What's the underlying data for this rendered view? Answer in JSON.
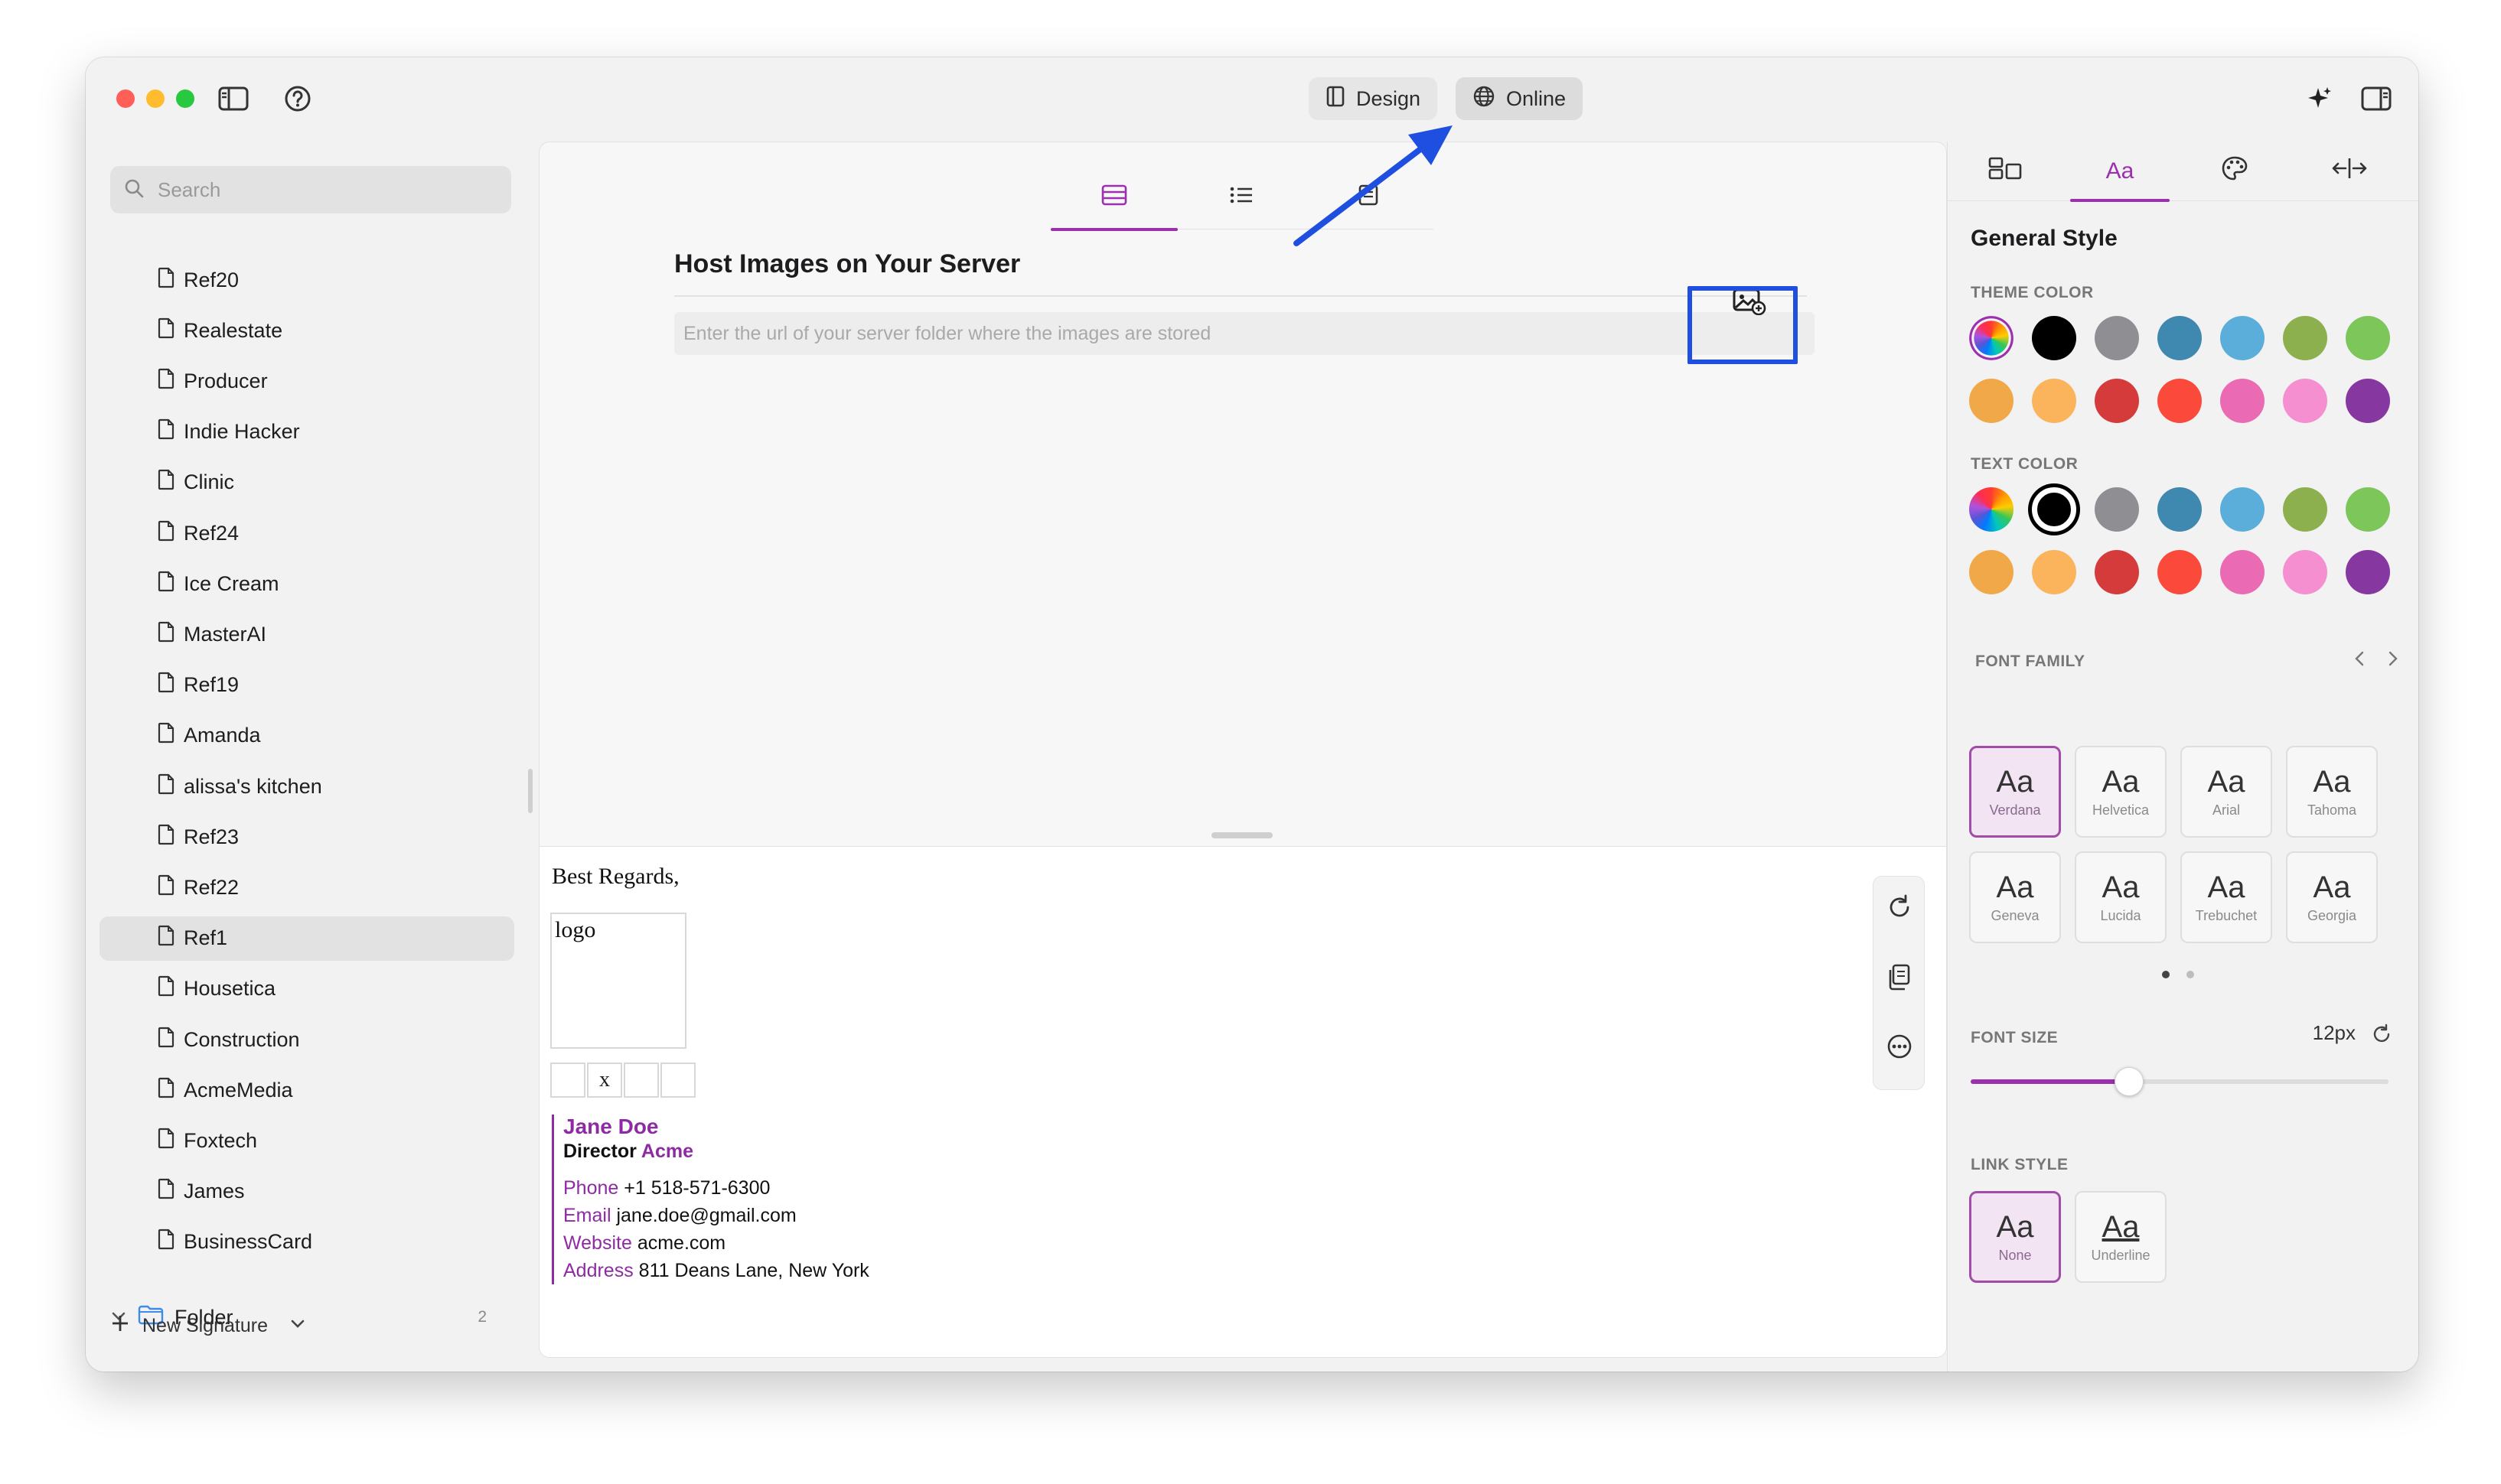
{
  "colors": {
    "accent": "#9b2fae",
    "annotation": "#1f4fe0",
    "traffic_red": "#ff5f57",
    "traffic_yellow": "#febc2e",
    "traffic_green": "#28c840"
  },
  "toolbar": {
    "design_label": "Design",
    "online_label": "Online",
    "active_mode": "Online"
  },
  "icons": {
    "sidebar_toggle": "sidebar-toggle-icon",
    "help": "help-icon",
    "design": "design-icon",
    "globe": "globe-icon",
    "ai_sparkle": "sparkle-icon",
    "inspector_toggle": "inspector-toggle-icon",
    "search": "search-icon",
    "document": "document-icon",
    "folder": "folder-icon",
    "image_upload": "image-upload-icon",
    "refresh": "refresh-icon",
    "copy": "copy-icon",
    "more": "more-icon"
  },
  "sidebar": {
    "search_placeholder": "Search",
    "items": [
      {
        "label": "Ref20"
      },
      {
        "label": "Realestate"
      },
      {
        "label": "Producer"
      },
      {
        "label": "Indie Hacker"
      },
      {
        "label": "Clinic"
      },
      {
        "label": "Ref24"
      },
      {
        "label": "Ice Cream"
      },
      {
        "label": "MasterAI"
      },
      {
        "label": "Ref19"
      },
      {
        "label": "Amanda"
      },
      {
        "label": "alissa's kitchen"
      },
      {
        "label": "Ref23"
      },
      {
        "label": "Ref22"
      },
      {
        "label": "Ref1",
        "selected": true
      },
      {
        "label": "Housetica"
      },
      {
        "label": "Construction"
      },
      {
        "label": "AcmeMedia"
      },
      {
        "label": "Foxtech"
      },
      {
        "label": "James"
      },
      {
        "label": "BusinessCard"
      }
    ],
    "folder": {
      "label": "Folder",
      "count": "2"
    },
    "new_signature_label": "New Signature"
  },
  "editor": {
    "active_tab": 0,
    "host_title": "Host Images on Your Server",
    "url_placeholder": "Enter the url of your server folder where the images are stored",
    "url_value": ""
  },
  "preview": {
    "regards": "Best Regards,",
    "logo_text": "logo",
    "social_text": "x",
    "name": "Jane Doe",
    "role": "Director",
    "company": "Acme",
    "contacts": [
      {
        "label": "Phone",
        "value": "+1 518-571-6300"
      },
      {
        "label": "Email",
        "value": "jane.doe@gmail.com"
      },
      {
        "label": "Website",
        "value": "acme.com"
      },
      {
        "label": "Address",
        "value": "811 Deans Lane, New York"
      }
    ]
  },
  "inspector": {
    "tab_text_label": "Aa",
    "title": "General Style",
    "theme_color_label": "THEME COLOR",
    "text_color_label": "TEXT COLOR",
    "theme_colors": [
      "custom",
      "#000000",
      "#8e8e93",
      "#3f88b0",
      "#5aaed9",
      "#8db04f",
      "#7cc65a",
      "#f0a848",
      "#fbb45b",
      "#d63b3b",
      "#fb4a3c",
      "#ea6bb3",
      "#f58fd0",
      "#8638a0"
    ],
    "text_colors": [
      "custom",
      "#000000",
      "#8e8e93",
      "#3f88b0",
      "#5aaed9",
      "#8db04f",
      "#7cc65a",
      "#f0a848",
      "#fbb45b",
      "#d63b3b",
      "#fb4a3c",
      "#ea6bb3",
      "#f58fd0",
      "#8638a0"
    ],
    "theme_selected": 0,
    "text_selected": 1,
    "font_family_label": "FONT FAMILY",
    "fonts": [
      {
        "sample": "Aa",
        "name": "Verdana"
      },
      {
        "sample": "Aa",
        "name": "Helvetica"
      },
      {
        "sample": "Aa",
        "name": "Arial"
      },
      {
        "sample": "Aa",
        "name": "Tahoma"
      },
      {
        "sample": "Aa",
        "name": "Geneva"
      },
      {
        "sample": "Aa",
        "name": "Lucida"
      },
      {
        "sample": "Aa",
        "name": "Trebuchet"
      },
      {
        "sample": "Aa",
        "name": "Georgia"
      }
    ],
    "font_selected": 0,
    "font_page": 1,
    "font_pages": 2,
    "font_size_label": "FONT SIZE",
    "font_size_value": "12px",
    "font_size_fraction": 0.38,
    "link_style_label": "LINK STYLE",
    "link_styles": [
      {
        "sample": "Aa",
        "name": "None"
      },
      {
        "sample": "Aa",
        "name": "Underline"
      }
    ],
    "link_selected": 0
  }
}
